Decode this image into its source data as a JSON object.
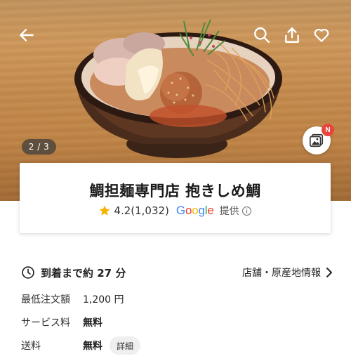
{
  "hero": {
    "counter": "2 / 3",
    "gallery_badge": "N"
  },
  "store": {
    "name": "鯛担麺専門店 抱きしめ鯛",
    "rating": "4.2",
    "review_count": "(1,032)",
    "source": "Google",
    "provided": "提供"
  },
  "delivery": {
    "eta": "到着まで約 27 分",
    "store_info_link": "店舗・原産地情報"
  },
  "details": [
    {
      "label": "最低注文額",
      "value": "1,200 円"
    },
    {
      "label": "サービス料",
      "value": "無料"
    },
    {
      "label": "送料",
      "value": "無料",
      "chip": "詳細"
    }
  ],
  "colors": {
    "google_blue": "#4285F4",
    "google_red": "#EA4335",
    "google_yellow": "#FBBC05",
    "google_green": "#34A853",
    "star": "#F5B300",
    "badge": "#e8453c"
  },
  "icons": {
    "back": "back-arrow-icon",
    "search": "search-icon",
    "share": "share-icon",
    "favorite": "heart-icon",
    "gallery": "gallery-icon",
    "clock": "clock-icon",
    "chevron": "chevron-right-icon",
    "info": "info-icon",
    "star": "star-icon"
  }
}
